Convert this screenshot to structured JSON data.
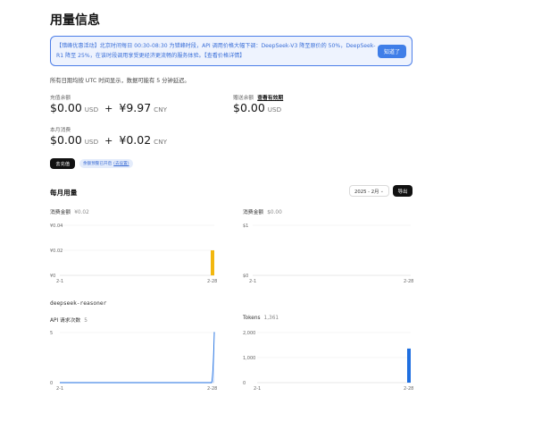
{
  "page": {
    "title": "用量信息"
  },
  "notice": {
    "text": "【错峰优惠活动】北京时间每日 00:30-08:30 为错峰时段，API 调用价格大幅下调：DeepSeek-V3 降至原价的 50%，DeepSeek-R1 降至 25%，在该时段调用享受更经济更流畅的服务体验。【查看价格详情】",
    "button": "知道了"
  },
  "utc_note": "所有日期均按 UTC 时间显示，数据可能有 5 分钟延迟。",
  "balance": {
    "recharge_label": "充值余额",
    "gift_label": "赠送余额",
    "gift_link": "查看有效期",
    "monthly_label": "本月消费",
    "recharge_usd": "$0.00",
    "recharge_cny": "¥9.97",
    "gift_usd": "$0.00",
    "monthly_usd": "$0.00",
    "monthly_cny": "¥0.02",
    "usd_unit": "USD",
    "cny_unit": "CNY",
    "plus": "+"
  },
  "actions": {
    "recharge_button": "去充值",
    "pill_text": "余额预警已开启",
    "pill_link": "(去设置)"
  },
  "monthly": {
    "title": "每月用量",
    "month_value": "2025 - 2月",
    "export_button": "导出"
  },
  "stats": {
    "cost_cny_label": "消费金额",
    "cost_cny_value": "¥0.02",
    "cost_usd_label": "消费金额",
    "cost_usd_value": "$0.00",
    "model": "deepseek-reasoner",
    "api_label": "API 请求次数",
    "api_value": "5",
    "tokens_label": "Tokens",
    "tokens_value": "1,361"
  },
  "colors": {
    "accent_blue": "#3f7ee8",
    "bar_yellow": "#f2b70f",
    "bar_blue": "#1f6fe0"
  },
  "chart_data": [
    {
      "type": "bar",
      "x_labels": [
        "2-1",
        "2-28"
      ],
      "y_ticks": [
        "¥0",
        "¥0.02",
        "¥0.04"
      ],
      "ylim": [
        0,
        0.04
      ],
      "bars": [
        {
          "day": 28,
          "value": 0.02
        }
      ],
      "days": 28,
      "color": "#f2b70f"
    },
    {
      "type": "bar",
      "x_labels": [
        "2-1",
        "2-28"
      ],
      "y_ticks": [
        "$0",
        "$1"
      ],
      "ylim": [
        0,
        1
      ],
      "bars": [],
      "days": 28,
      "color": "#1f6fe0"
    },
    {
      "type": "area",
      "x_labels": [
        "2-1",
        "2-28"
      ],
      "y_ticks": [
        "0",
        "5"
      ],
      "ylim": [
        0,
        5
      ],
      "points": [
        {
          "day": 27.5,
          "value": 0
        },
        {
          "day": 28,
          "value": 5
        }
      ],
      "days": 28,
      "color": "#1f6fe0"
    },
    {
      "type": "bar",
      "x_labels": [
        "2-1",
        "2-28"
      ],
      "y_ticks": [
        "0",
        "1,000",
        "2,000"
      ],
      "ylim": [
        0,
        2000
      ],
      "bars": [
        {
          "day": 28,
          "value": 1361
        }
      ],
      "days": 28,
      "color": "#1f6fe0"
    }
  ]
}
